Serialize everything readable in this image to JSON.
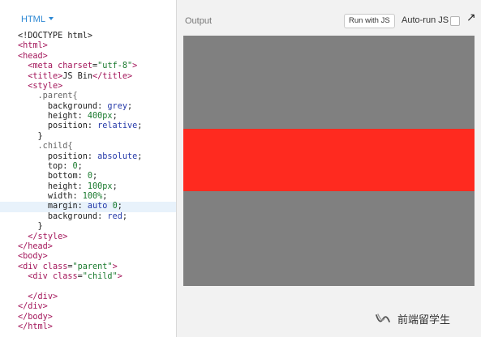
{
  "editor": {
    "tab_label": "HTML",
    "lines": [
      [
        {
          "c": "p",
          "v": "<!DOCTYPE html>"
        }
      ],
      [
        {
          "c": "t",
          "v": "<html>"
        }
      ],
      [
        {
          "c": "t",
          "v": "<head>"
        }
      ],
      [
        {
          "c": "p",
          "v": "  "
        },
        {
          "c": "t",
          "v": "<meta "
        },
        {
          "c": "a",
          "v": "charset"
        },
        {
          "c": "p",
          "v": "="
        },
        {
          "c": "s",
          "v": "\"utf-8\""
        },
        {
          "c": "t",
          "v": ">"
        }
      ],
      [
        {
          "c": "p",
          "v": "  "
        },
        {
          "c": "t",
          "v": "<title>"
        },
        {
          "c": "p",
          "v": "JS Bin"
        },
        {
          "c": "t",
          "v": "</title>"
        }
      ],
      [
        {
          "c": "p",
          "v": "  "
        },
        {
          "c": "t",
          "v": "<style>"
        }
      ],
      [
        {
          "c": "p",
          "v": "    "
        },
        {
          "c": "sel",
          "v": ".parent{"
        }
      ],
      [
        {
          "c": "p",
          "v": "      "
        },
        {
          "c": "prop",
          "v": "background: "
        },
        {
          "c": "val",
          "v": "grey"
        },
        {
          "c": "p",
          "v": ";"
        }
      ],
      [
        {
          "c": "p",
          "v": "      "
        },
        {
          "c": "prop",
          "v": "height: "
        },
        {
          "c": "num",
          "v": "400px"
        },
        {
          "c": "p",
          "v": ";"
        }
      ],
      [
        {
          "c": "p",
          "v": "      "
        },
        {
          "c": "prop",
          "v": "position: "
        },
        {
          "c": "val",
          "v": "relative"
        },
        {
          "c": "p",
          "v": ";"
        }
      ],
      [
        {
          "c": "p",
          "v": "    }"
        }
      ],
      [
        {
          "c": "p",
          "v": "    "
        },
        {
          "c": "sel",
          "v": ".child{"
        }
      ],
      [
        {
          "c": "p",
          "v": "      "
        },
        {
          "c": "prop",
          "v": "position: "
        },
        {
          "c": "val",
          "v": "absolute"
        },
        {
          "c": "p",
          "v": ";"
        }
      ],
      [
        {
          "c": "p",
          "v": "      "
        },
        {
          "c": "prop",
          "v": "top: "
        },
        {
          "c": "num",
          "v": "0"
        },
        {
          "c": "p",
          "v": ";"
        }
      ],
      [
        {
          "c": "p",
          "v": "      "
        },
        {
          "c": "prop",
          "v": "bottom: "
        },
        {
          "c": "num",
          "v": "0"
        },
        {
          "c": "p",
          "v": ";"
        }
      ],
      [
        {
          "c": "p",
          "v": "      "
        },
        {
          "c": "prop",
          "v": "height: "
        },
        {
          "c": "num",
          "v": "100px"
        },
        {
          "c": "p",
          "v": ";"
        }
      ],
      [
        {
          "c": "p",
          "v": "      "
        },
        {
          "c": "prop",
          "v": "width: "
        },
        {
          "c": "num",
          "v": "100%"
        },
        {
          "c": "p",
          "v": ";"
        }
      ],
      [
        {
          "c": "p",
          "v": "      "
        },
        {
          "c": "prop",
          "v": "margin: "
        },
        {
          "c": "val",
          "v": "auto "
        },
        {
          "c": "num",
          "v": "0"
        },
        {
          "c": "p",
          "v": ";"
        }
      ],
      [
        {
          "c": "p",
          "v": "      "
        },
        {
          "c": "prop",
          "v": "background: "
        },
        {
          "c": "val",
          "v": "red"
        },
        {
          "c": "p",
          "v": ";"
        }
      ],
      [
        {
          "c": "p",
          "v": "    }"
        }
      ],
      [
        {
          "c": "p",
          "v": "  "
        },
        {
          "c": "t",
          "v": "</style>"
        }
      ],
      [
        {
          "c": "t",
          "v": "</head>"
        }
      ],
      [
        {
          "c": "t",
          "v": "<body>"
        }
      ],
      [
        {
          "c": "t",
          "v": "<div "
        },
        {
          "c": "a",
          "v": "class"
        },
        {
          "c": "p",
          "v": "="
        },
        {
          "c": "s",
          "v": "\"parent\""
        },
        {
          "c": "t",
          "v": ">"
        }
      ],
      [
        {
          "c": "p",
          "v": "  "
        },
        {
          "c": "t",
          "v": "<div "
        },
        {
          "c": "a",
          "v": "class"
        },
        {
          "c": "p",
          "v": "="
        },
        {
          "c": "s",
          "v": "\"child\""
        },
        {
          "c": "t",
          "v": ">"
        }
      ],
      [
        {
          "c": "p",
          "v": ""
        }
      ],
      [
        {
          "c": "p",
          "v": "  "
        },
        {
          "c": "t",
          "v": "</div>"
        }
      ],
      [
        {
          "c": "t",
          "v": "</div>"
        }
      ],
      [
        {
          "c": "t",
          "v": "</body>"
        }
      ],
      [
        {
          "c": "t",
          "v": "</html>"
        }
      ]
    ],
    "active_line": 17
  },
  "output": {
    "title": "Output",
    "run_button_label": "Run with JS",
    "autorun_label": "Auto-run JS",
    "autorun_checked": false,
    "popout_icon": "↗",
    "preview": {
      "parent_color": "#808080",
      "child_color": "#ff2a1f"
    }
  },
  "watermark": {
    "text": "前端留学生",
    "icon": "wechat-channel-icon"
  }
}
